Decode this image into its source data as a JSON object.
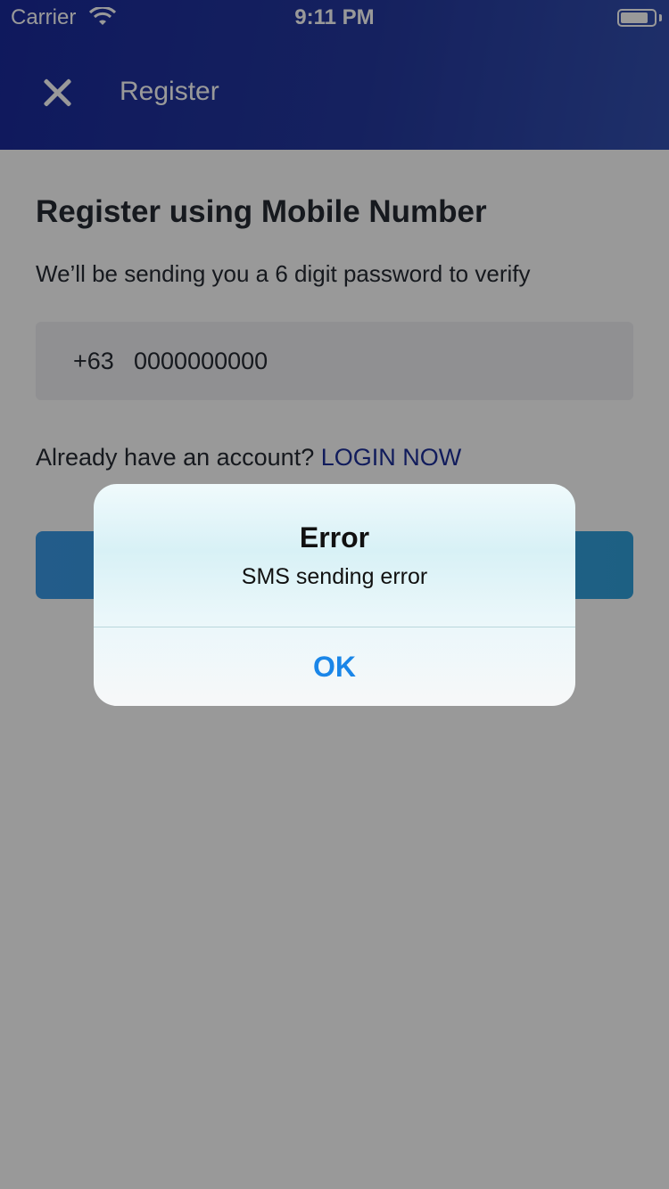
{
  "status_bar": {
    "carrier": "Carrier",
    "time": "9:11 PM"
  },
  "header": {
    "title": "Register",
    "close_icon": "close-icon"
  },
  "register": {
    "title": "Register using Mobile Number",
    "subtitle": "We’ll be sending you a 6 digit password to verify",
    "country_code": "+63",
    "phone_value": "0000000000",
    "login_prompt": "Already have an account?",
    "login_link": "LOGIN NOW"
  },
  "alert": {
    "title": "Error",
    "message": "SMS sending error",
    "ok_label": "OK"
  },
  "colors": {
    "header": "#1a2a9c",
    "accent_link": "#1d2f9a",
    "alert_button": "#1a86e8",
    "primary_button": "#3b9ae6"
  }
}
